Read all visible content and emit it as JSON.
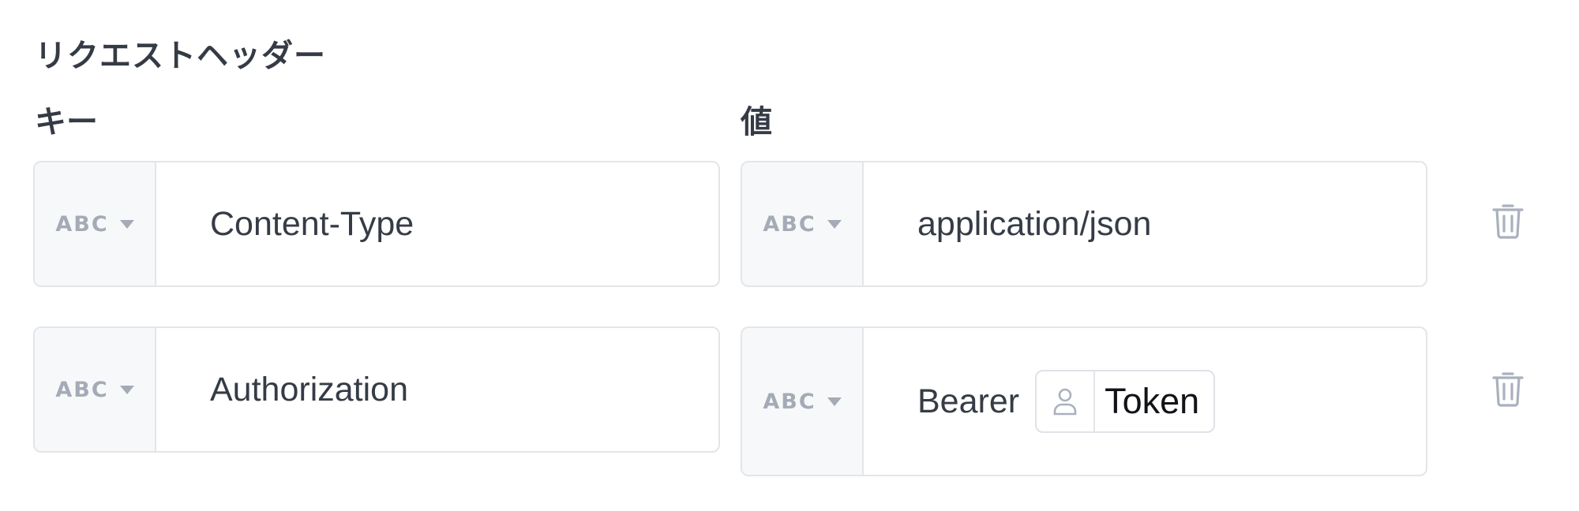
{
  "section_title": "リクエストヘッダー",
  "columns": {
    "key_label": "キー",
    "value_label": "値"
  },
  "type_badge": "ABC",
  "headers": [
    {
      "key": "Content-Type",
      "value": "application/json"
    },
    {
      "key": "Authorization",
      "value_prefix": "Bearer",
      "value_token": "Token",
      "token_icon": "user-icon"
    }
  ],
  "icons": {
    "delete": "trash-icon",
    "type_dropdown": "caret-down-icon"
  },
  "colors": {
    "border": "#e3e5e9",
    "badge": "#a4abb6",
    "text": "#363c46",
    "icon": "#a9b1bd"
  }
}
